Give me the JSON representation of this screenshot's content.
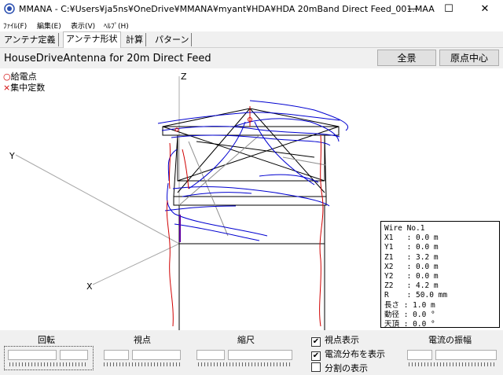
{
  "window": {
    "title": "MMANA - C:¥Users¥ja5ns¥OneDrive¥MMANA¥myant¥HDA¥HDA 20mBand Direct Feed_001.MAA",
    "minimize": "—",
    "maximize": "☐",
    "close": "✕"
  },
  "menu": [
    "ﾌｧｲﾙ(F)",
    "編集(E)",
    "表示(V)",
    "ﾍﾙﾌﾟ(H)"
  ],
  "tabs": [
    "アンテナ定義",
    "アンテナ形状",
    "計算",
    "パターン"
  ],
  "active_tab": 1,
  "header": {
    "model_title": "HouseDriveAntenna for 20m Direct Feed",
    "fit_button": "全景",
    "origin_button": "原点中心"
  },
  "view": {
    "legend_feed_marker": "○",
    "legend_feed": "給電点",
    "legend_load_marker": "×",
    "legend_load": "集中定数",
    "axis_x": "X",
    "axis_y": "Y",
    "axis_z": "Z"
  },
  "wire_info": [
    "Wire No.1",
    "X1   : 0.0 m",
    "Y1   : 0.0 m",
    "Z1   : 3.2 m",
    "X2   : 0.0 m",
    "Y2   : 0.0 m",
    "Z2   : 4.2 m",
    "R    : 50.0 mm",
    "長さ : 1.0 m",
    "動径 : 0.0 °",
    "天頂 : 0.0 °"
  ],
  "controls": {
    "rotation_label": "回転",
    "viewpoint_label": "視点",
    "scale_label": "縮尺",
    "current_amp_label": "電流の振幅",
    "show_viewpoint_label": "視点表示",
    "show_current_label": "電流分布を表示",
    "show_segments_label": "分割の表示",
    "show_viewpoint_checked": true,
    "show_current_checked": true,
    "show_segments_checked": false,
    "check_mark": "✔"
  },
  "colors": {
    "wire": "#000000",
    "current": "#0000d0",
    "current_alt": "#d00000",
    "feed": "#d00000",
    "axis": "#a0a0a0"
  }
}
